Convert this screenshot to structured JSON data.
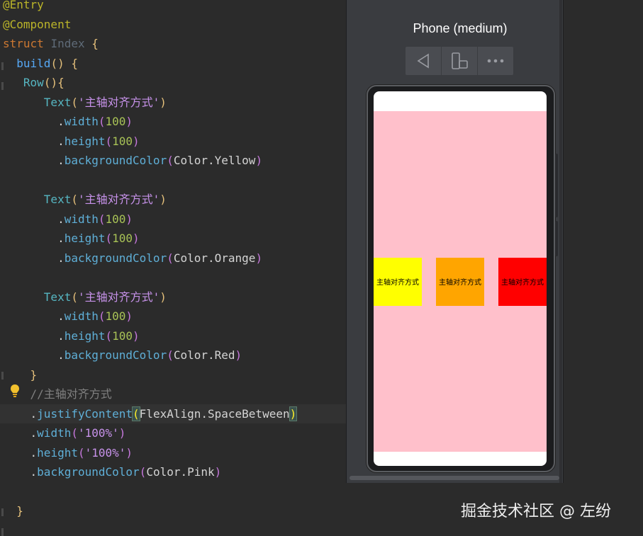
{
  "editor": {
    "lines": [
      {
        "id": "l1",
        "tokens": [
          [
            "ann",
            "@Entry"
          ]
        ]
      },
      {
        "id": "l2",
        "tokens": [
          [
            "ann",
            "@Component"
          ]
        ]
      },
      {
        "id": "l3",
        "tokens": [
          [
            "kw",
            "struct "
          ],
          [
            "ty",
            "Index "
          ],
          [
            "br",
            "{"
          ]
        ]
      },
      {
        "id": "l4",
        "tokens": [
          [
            "plain",
            "  "
          ],
          [
            "fn",
            "build"
          ],
          [
            "br",
            "() {"
          ]
        ]
      },
      {
        "id": "l5",
        "tokens": [
          [
            "plain",
            "   "
          ],
          [
            "ct",
            "Row"
          ],
          [
            "br",
            "(){"
          ]
        ]
      },
      {
        "id": "l6",
        "tokens": [
          [
            "plain",
            "      "
          ],
          [
            "ct",
            "Text"
          ],
          [
            "br",
            "("
          ],
          [
            "str",
            "'主轴对齐方式'"
          ],
          [
            "br",
            ")"
          ]
        ]
      },
      {
        "id": "l7",
        "tokens": [
          [
            "plain",
            "        ."
          ],
          [
            "method",
            "width"
          ],
          [
            "pn",
            "("
          ],
          [
            "num",
            "100"
          ],
          [
            "pn",
            ")"
          ]
        ]
      },
      {
        "id": "l8",
        "tokens": [
          [
            "plain",
            "        ."
          ],
          [
            "method",
            "height"
          ],
          [
            "pn",
            "("
          ],
          [
            "num",
            "100"
          ],
          [
            "pn",
            ")"
          ]
        ]
      },
      {
        "id": "l9",
        "tokens": [
          [
            "plain",
            "        ."
          ],
          [
            "method",
            "backgroundColor"
          ],
          [
            "pn",
            "("
          ],
          [
            "plain",
            "Color.Yellow"
          ],
          [
            "pn",
            ")"
          ]
        ]
      },
      {
        "id": "l10",
        "tokens": []
      },
      {
        "id": "l11",
        "tokens": [
          [
            "plain",
            "      "
          ],
          [
            "ct",
            "Text"
          ],
          [
            "br",
            "("
          ],
          [
            "str",
            "'主轴对齐方式'"
          ],
          [
            "br",
            ")"
          ]
        ]
      },
      {
        "id": "l12",
        "tokens": [
          [
            "plain",
            "        ."
          ],
          [
            "method",
            "width"
          ],
          [
            "pn",
            "("
          ],
          [
            "num",
            "100"
          ],
          [
            "pn",
            ")"
          ]
        ]
      },
      {
        "id": "l13",
        "tokens": [
          [
            "plain",
            "        ."
          ],
          [
            "method",
            "height"
          ],
          [
            "pn",
            "("
          ],
          [
            "num",
            "100"
          ],
          [
            "pn",
            ")"
          ]
        ]
      },
      {
        "id": "l14",
        "tokens": [
          [
            "plain",
            "        ."
          ],
          [
            "method",
            "backgroundColor"
          ],
          [
            "pn",
            "("
          ],
          [
            "plain",
            "Color.Orange"
          ],
          [
            "pn",
            ")"
          ]
        ]
      },
      {
        "id": "l15",
        "tokens": []
      },
      {
        "id": "l16",
        "tokens": [
          [
            "plain",
            "      "
          ],
          [
            "ct",
            "Text"
          ],
          [
            "br",
            "("
          ],
          [
            "str",
            "'主轴对齐方式'"
          ],
          [
            "br",
            ")"
          ]
        ]
      },
      {
        "id": "l17",
        "tokens": [
          [
            "plain",
            "        ."
          ],
          [
            "method",
            "width"
          ],
          [
            "pn",
            "("
          ],
          [
            "num",
            "100"
          ],
          [
            "pn",
            ")"
          ]
        ]
      },
      {
        "id": "l18",
        "tokens": [
          [
            "plain",
            "        ."
          ],
          [
            "method",
            "height"
          ],
          [
            "pn",
            "("
          ],
          [
            "num",
            "100"
          ],
          [
            "pn",
            ")"
          ]
        ]
      },
      {
        "id": "l19",
        "tokens": [
          [
            "plain",
            "        ."
          ],
          [
            "method",
            "backgroundColor"
          ],
          [
            "pn",
            "("
          ],
          [
            "plain",
            "Color.Red"
          ],
          [
            "pn",
            ")"
          ]
        ]
      },
      {
        "id": "l20",
        "tokens": [
          [
            "plain",
            "    "
          ],
          [
            "br",
            "}"
          ]
        ]
      },
      {
        "id": "l21",
        "tokens": [
          [
            "plain",
            "    "
          ],
          [
            "cm",
            "//主轴对齐方式"
          ]
        ]
      },
      {
        "id": "l22",
        "tokens": [
          [
            "plain",
            "    ."
          ],
          [
            "method",
            "justifyContent"
          ],
          [
            "cursor",
            "("
          ],
          [
            "plain",
            "FlexAlign.SpaceBetween"
          ],
          [
            "cursor",
            ")"
          ]
        ]
      },
      {
        "id": "l23",
        "tokens": [
          [
            "plain",
            "    ."
          ],
          [
            "method",
            "width"
          ],
          [
            "pn",
            "("
          ],
          [
            "str",
            "'100%'"
          ],
          [
            "pn",
            ")"
          ]
        ]
      },
      {
        "id": "l24",
        "tokens": [
          [
            "plain",
            "    ."
          ],
          [
            "method",
            "height"
          ],
          [
            "pn",
            "("
          ],
          [
            "str",
            "'100%'"
          ],
          [
            "pn",
            ")"
          ]
        ]
      },
      {
        "id": "l25",
        "tokens": [
          [
            "plain",
            "    ."
          ],
          [
            "method",
            "backgroundColor"
          ],
          [
            "pn",
            "("
          ],
          [
            "plain",
            "Color.Pink"
          ],
          [
            "pn",
            ")"
          ]
        ]
      },
      {
        "id": "l26",
        "tokens": []
      },
      {
        "id": "l27",
        "tokens": [
          [
            "plain",
            "  "
          ],
          [
            "br",
            "}"
          ]
        ]
      }
    ],
    "current_line": "l22"
  },
  "previewer": {
    "device_title": "Phone (medium)",
    "toolbar": {
      "back_icon": "back-triangle-icon",
      "rotate_icon": "device-rotate-icon",
      "more_icon": "more-dots-icon"
    },
    "app": {
      "row_color": "#ffc0cb",
      "boxes": [
        {
          "label": "主轴对齐方式",
          "color": "#ffff00"
        },
        {
          "label": "主轴对齐方式",
          "color": "#ffa500"
        },
        {
          "label": "主轴对齐方式",
          "color": "#ff0000"
        }
      ]
    }
  },
  "watermark": "掘金技术社区 @ 左纷"
}
